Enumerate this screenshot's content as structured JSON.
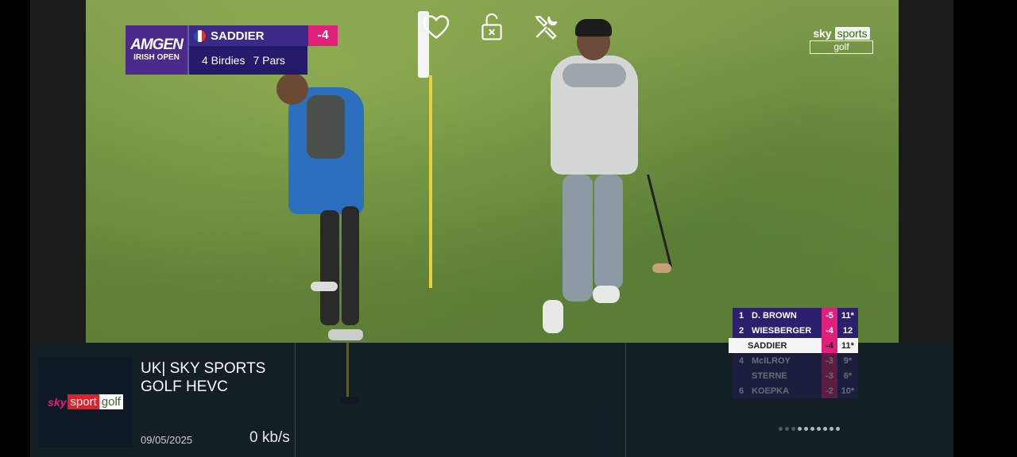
{
  "scorebug": {
    "event_logo_line1": "AMGEN",
    "event_logo_line2": "IRISH OPEN",
    "player": "SADDIER",
    "score": "-4",
    "birdies": "4 Birdies",
    "pars": "7 Pars"
  },
  "controls": [
    {
      "icon": "heart-icon"
    },
    {
      "icon": "unlock-icon"
    },
    {
      "icon": "tools-icon"
    }
  ],
  "broadcaster_logo": {
    "line1_a": "sky",
    "line1_b": "sports",
    "line2": "golf"
  },
  "leaderboard": [
    {
      "pos": "1",
      "name": "D. BROWN",
      "score": "-5",
      "thru": "11*"
    },
    {
      "pos": "2",
      "name": "WIESBERGER",
      "score": "-4",
      "thru": "12"
    },
    {
      "pos": "",
      "name": "SADDIER",
      "score": "-4",
      "thru": "11*"
    },
    {
      "pos": "4",
      "name": "McILROY",
      "score": "-3",
      "thru": "9*"
    },
    {
      "pos": "",
      "name": "STERNE",
      "score": "-3",
      "thru": "6*"
    },
    {
      "pos": "6",
      "name": "KOEPKA",
      "score": "-2",
      "thru": "10*"
    }
  ],
  "channel": {
    "logo_sky": "sky",
    "logo_sport": "sport",
    "logo_golf": "golf",
    "name": "UK| SKY SPORTS GOLF HEVC",
    "date": "09/05/2025",
    "bitrate": "0 kb/s"
  },
  "colors": {
    "accent_pink": "#e0207a",
    "board_purple": "#2b1f6e",
    "infobar": "#142028"
  }
}
